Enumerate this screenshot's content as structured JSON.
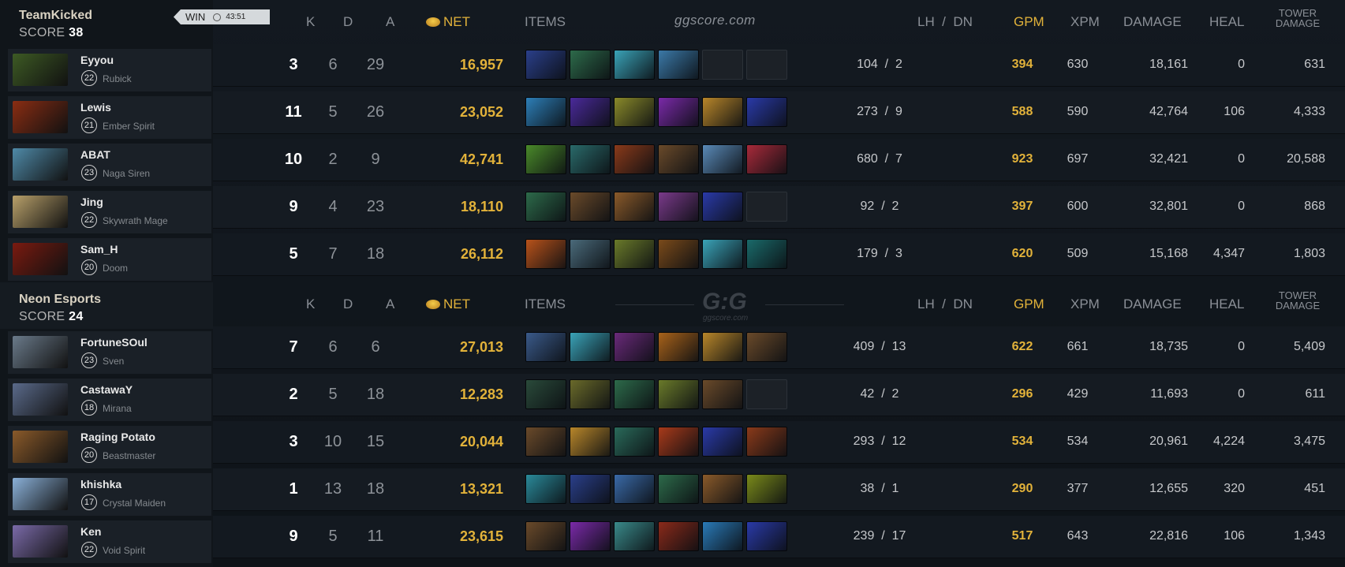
{
  "match": {
    "result": "WIN",
    "duration": "43:51"
  },
  "headers": {
    "k": "K",
    "d": "D",
    "a": "A",
    "net": "NET",
    "items": "ITEMS",
    "lh_dn": "LH  /  DN",
    "gpm": "GPM",
    "xpm": "XPM",
    "damage": "DAMAGE",
    "heal": "HEAL",
    "tower_line1": "TOWER",
    "tower_line2": "DAMAGE"
  },
  "watermark": {
    "site": "ggscore.com",
    "logo": "G:G"
  },
  "teams": [
    {
      "name": "TeamKicked",
      "score_label": "SCORE",
      "score": "38",
      "players": [
        {
          "name": "Eyyou",
          "level": "22",
          "hero": "Rubick",
          "avatar_color": "#3d5a24",
          "k": "3",
          "d": "6",
          "a": "29",
          "net": "16,957",
          "lh_dn": "104  /  2",
          "gpm": "394",
          "xpm": "630",
          "damage": "18,161",
          "heal": "0",
          "tower": "631",
          "items": [
            "#2a3f8a",
            "#2d6a4a",
            "#3aa3b8",
            "#3b79a8",
            "empty",
            "empty"
          ]
        },
        {
          "name": "Lewis",
          "level": "21",
          "hero": "Ember Spirit",
          "avatar_color": "#8a2d12",
          "k": "11",
          "d": "5",
          "a": "26",
          "net": "23,052",
          "lh_dn": "273  /  9",
          "gpm": "588",
          "xpm": "590",
          "damage": "42,764",
          "heal": "106",
          "tower": "4,333",
          "items": [
            "#2d7fb8",
            "#4a2a9a",
            "#8a8a2a",
            "#7a2aa8",
            "#b8862a",
            "#2a3aa8"
          ]
        },
        {
          "name": "ABAT",
          "level": "23",
          "hero": "Naga Siren",
          "avatar_color": "#4f8aa8",
          "k": "10",
          "d": "2",
          "a": "9",
          "net": "42,741",
          "lh_dn": "680  /  7",
          "gpm": "923",
          "xpm": "697",
          "damage": "32,421",
          "heal": "0",
          "tower": "20,588",
          "items": [
            "#4a8a2a",
            "#2a6a6a",
            "#8a3a1a",
            "#6a4a2a",
            "#5a8ab8",
            "#a82a3a"
          ]
        },
        {
          "name": "Jing",
          "level": "22",
          "hero": "Skywrath Mage",
          "avatar_color": "#b8a06a",
          "k": "9",
          "d": "4",
          "a": "23",
          "net": "18,110",
          "lh_dn": "92  /  2",
          "gpm": "397",
          "xpm": "600",
          "damage": "32,801",
          "heal": "0",
          "tower": "868",
          "items": [
            "#2d6a4a",
            "#6a4a2a",
            "#8a5a2a",
            "#7a3a8a",
            "#2a3aa8",
            "empty"
          ]
        },
        {
          "name": "Sam_H",
          "level": "20",
          "hero": "Doom",
          "avatar_color": "#7a1a10",
          "k": "5",
          "d": "7",
          "a": "18",
          "net": "26,112",
          "lh_dn": "179  /  3",
          "gpm": "620",
          "xpm": "509",
          "damage": "15,168",
          "heal": "4,347",
          "tower": "1,803",
          "items": [
            "#b8521a",
            "#4a6a7a",
            "#6a7a2a",
            "#7a4a1a",
            "#3aa3b8",
            "#1a6a6a"
          ]
        }
      ]
    },
    {
      "name": "Neon Esports",
      "score_label": "SCORE",
      "score": "24",
      "players": [
        {
          "name": "FortuneSOul",
          "level": "23",
          "hero": "Sven",
          "avatar_color": "#6a7a8a",
          "k": "7",
          "d": "6",
          "a": "6",
          "net": "27,013",
          "lh_dn": "409  /  13",
          "gpm": "622",
          "xpm": "661",
          "damage": "18,735",
          "heal": "0",
          "tower": "5,409",
          "items": [
            "#3a5a8a",
            "#3aa3b8",
            "#6a2a7a",
            "#a8621a",
            "#b8862a",
            "#6a4a2a"
          ]
        },
        {
          "name": "CastawaY",
          "level": "18",
          "hero": "Mirana",
          "avatar_color": "#5a6a8a",
          "k": "2",
          "d": "5",
          "a": "18",
          "net": "12,283",
          "lh_dn": "42  /  2",
          "gpm": "296",
          "xpm": "429",
          "damage": "11,693",
          "heal": "0",
          "tower": "611",
          "items": [
            "#2a4a3a",
            "#6a6a2a",
            "#2d6a4a",
            "#6a7a2a",
            "#6a4a2a",
            "empty"
          ]
        },
        {
          "name": "Raging Potato",
          "level": "20",
          "hero": "Beastmaster",
          "avatar_color": "#8a5a2a",
          "k": "3",
          "d": "10",
          "a": "15",
          "net": "20,044",
          "lh_dn": "293  /  12",
          "gpm": "534",
          "xpm": "534",
          "damage": "20,961",
          "heal": "4,224",
          "tower": "3,475",
          "items": [
            "#6a4a2a",
            "#b8862a",
            "#2a6a5a",
            "#a83a1a",
            "#2a3aa8",
            "#8a3a1a"
          ]
        },
        {
          "name": "khishka",
          "level": "17",
          "hero": "Crystal Maiden",
          "avatar_color": "#8ab0d8",
          "k": "1",
          "d": "13",
          "a": "18",
          "net": "13,321",
          "lh_dn": "38  /  1",
          "gpm": "290",
          "xpm": "377",
          "damage": "12,655",
          "heal": "320",
          "tower": "451",
          "items": [
            "#2a8a9a",
            "#2a3f8a",
            "#3a6aa8",
            "#2d6a4a",
            "#8a5a2a",
            "#7a8a1a"
          ]
        },
        {
          "name": "Ken",
          "level": "22",
          "hero": "Void Spirit",
          "avatar_color": "#7a6aa8",
          "k": "9",
          "d": "5",
          "a": "11",
          "net": "23,615",
          "lh_dn": "239  /  17",
          "gpm": "517",
          "xpm": "643",
          "damage": "22,816",
          "heal": "106",
          "tower": "1,343",
          "items": [
            "#6a4a2a",
            "#7a2aa8",
            "#3a8a8a",
            "#8a2a1a",
            "#2a7ab8",
            "#2a3aa8"
          ]
        }
      ]
    }
  ]
}
